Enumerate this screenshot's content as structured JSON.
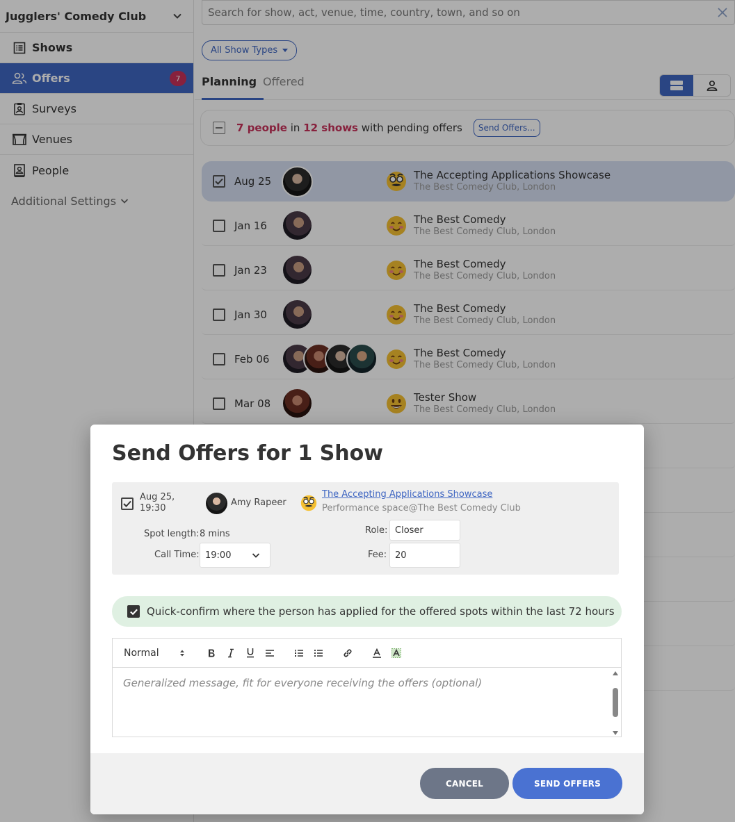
{
  "sidebar": {
    "org_name": "Jugglers' Comedy Club",
    "items": [
      {
        "label": "Shows"
      },
      {
        "label": "Offers",
        "badge": "7"
      },
      {
        "label": "Surveys"
      },
      {
        "label": "Venues"
      },
      {
        "label": "People"
      }
    ],
    "additional_label": "Additional Settings"
  },
  "search": {
    "placeholder": "Search for show, act, venue, time, country, town, and so on"
  },
  "filter": {
    "show_types_label": "All Show Types"
  },
  "tabs": {
    "planning": "Planning",
    "offered": "Offered"
  },
  "summary": {
    "people": "7 people",
    "in": "in",
    "shows": "12 shows",
    "rest": "with pending offers",
    "send_button": "Send Offers..."
  },
  "rows": [
    {
      "date": "Aug 25",
      "title": "The Accepting Applications Showcase",
      "venue": "The Best Comedy Club, London"
    },
    {
      "date": "Jan 16",
      "title": "The Best Comedy",
      "venue": "The Best Comedy Club, London"
    },
    {
      "date": "Jan 23",
      "title": "The Best Comedy",
      "venue": "The Best Comedy Club, London"
    },
    {
      "date": "Jan 30",
      "title": "The Best Comedy",
      "venue": "The Best Comedy Club, London"
    },
    {
      "date": "Feb 06",
      "title": "The Best Comedy",
      "venue": "The Best Comedy Club, London"
    },
    {
      "date": "Mar 08",
      "title": "Tester Show",
      "venue": "The Best Comedy Club, London"
    }
  ],
  "modal": {
    "title": "Send Offers for 1 Show",
    "offer": {
      "date_line1": "Aug 25,",
      "date_line2": "19:30",
      "person": "Amy Rapeer",
      "show_link": "The Accepting Applications Showcase",
      "venue": "Performance space@The Best Comedy Club",
      "spot_length_label": "Spot length:",
      "spot_length_value": "8 mins",
      "call_time_label": "Call Time:",
      "call_time_value": "19:00",
      "role_label": "Role:",
      "role_value": "Closer",
      "fee_label": "Fee:",
      "fee_value": "20"
    },
    "quick_confirm": "Quick-confirm where the person has applied for the offered spots within the last 72 hours",
    "editor": {
      "format": "Normal",
      "placeholder": "Generalized message, fit for everyone receiving the offers (optional)"
    },
    "cancel": "CANCEL",
    "send": "SEND OFFERS"
  }
}
